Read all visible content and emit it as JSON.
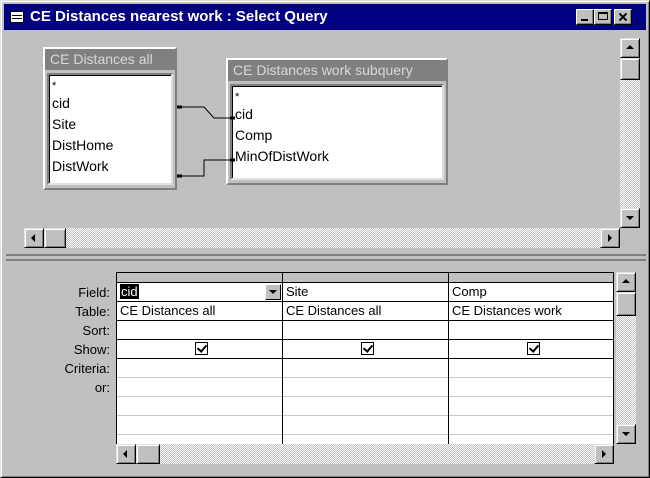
{
  "window": {
    "title": "CE Distances nearest work : Select Query"
  },
  "tables": [
    {
      "name": "CE Distances all",
      "fields": [
        "*",
        "cid",
        "Site",
        "DistHome",
        "DistWork"
      ]
    },
    {
      "name": "CE Distances work subquery",
      "fields": [
        "*",
        "cid",
        "Comp",
        "MinOfDistWork"
      ]
    }
  ],
  "grid": {
    "row_labels": [
      "Field:",
      "Table:",
      "Sort:",
      "Show:",
      "Criteria:",
      "or:"
    ],
    "columns": [
      {
        "field": "cid",
        "table": "CE Distances all",
        "sort": "",
        "show": true
      },
      {
        "field": "Site",
        "table": "CE Distances all",
        "sort": "",
        "show": true
      },
      {
        "field": "Comp",
        "table": "CE Distances work",
        "sort": "",
        "show": true
      }
    ]
  },
  "icons": {
    "window_icon": "query-grid-icon",
    "minimize": "minimize-icon",
    "maximize": "maximize-icon",
    "close": "close-icon",
    "dropdown": "chevron-down-icon",
    "checkbox": "checkmark-icon"
  },
  "colors": {
    "titlebar": "#000080",
    "face": "#c0c0c0",
    "inactive_header": "#808080"
  }
}
